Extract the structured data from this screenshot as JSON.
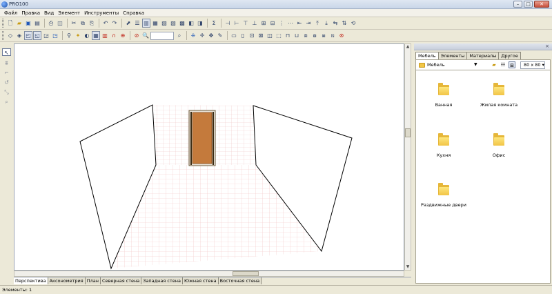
{
  "window": {
    "title": "PRO100",
    "minimize": "–",
    "maximize": "□",
    "close": "✕"
  },
  "menu": [
    "Файл",
    "Правка",
    "Вид",
    "Элемент",
    "Инструменты",
    "Справка"
  ],
  "viewport_tabs": [
    "Перспектива",
    "Аксонометрия",
    "План",
    "Северная стена",
    "Западная стена",
    "Южная стена",
    "Восточная стена"
  ],
  "panel": {
    "tabs": [
      "Мебель",
      "Элементы",
      "Материалы",
      "Другое"
    ],
    "path": "Мебель",
    "size": "80 x 80",
    "categories": [
      {
        "label": "Ванная"
      },
      {
        "label": "Жилая комната"
      },
      {
        "label": "Кухня"
      },
      {
        "label": "Офис"
      },
      {
        "label": "Раздвижные двери"
      }
    ]
  },
  "status": {
    "text": "Элементы: 1"
  }
}
